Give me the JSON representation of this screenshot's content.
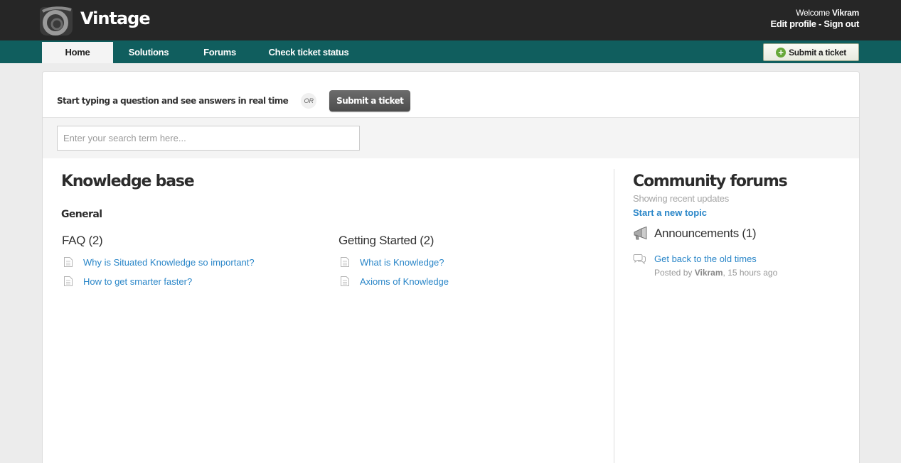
{
  "header": {
    "brand": "Vintage",
    "welcome_prefix": "Welcome",
    "user_name": "Vikram",
    "edit_profile": "Edit profile",
    "separator": " - ",
    "sign_out": "Sign out"
  },
  "nav": {
    "tabs": [
      {
        "label": "Home",
        "active": true
      },
      {
        "label": "Solutions"
      },
      {
        "label": "Forums"
      },
      {
        "label": "Check ticket status"
      }
    ],
    "submit_ticket": "Submit a ticket"
  },
  "search": {
    "prompt": "Start typing a question and see answers in real time",
    "or_label": "OR",
    "submit_label": "Submit a ticket",
    "placeholder": "Enter your search term here..."
  },
  "knowledge_base": {
    "title": "Knowledge base",
    "category": "General",
    "folders": [
      {
        "title": "FAQ (2)",
        "articles": [
          "Why is Situated Knowledge so important?",
          "How to get smarter faster?"
        ]
      },
      {
        "title": "Getting Started (2)",
        "articles": [
          "What is Knowledge?",
          "Axioms of Knowledge"
        ]
      }
    ]
  },
  "community": {
    "title": "Community forums",
    "subtitle": "Showing recent updates",
    "new_topic": "Start a new topic",
    "forum_name": "Announcements (1)",
    "topic_title": "Get back to the old times",
    "posted_by_prefix": "Posted by",
    "posted_by_user": "Vikram",
    "posted_time": ", 15 hours ago"
  },
  "colors": {
    "header_bg": "#262626",
    "nav_bg": "#105e5e",
    "link": "#2a86c8"
  }
}
